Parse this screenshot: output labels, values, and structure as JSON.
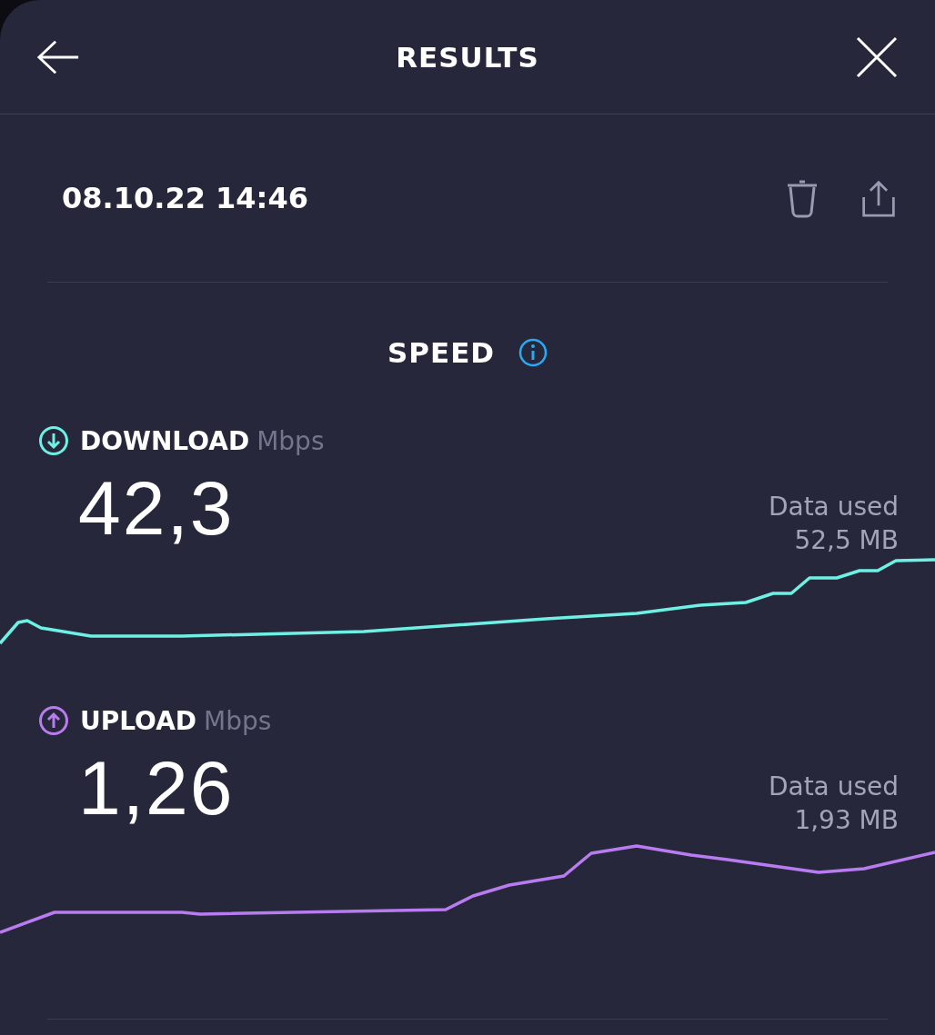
{
  "header": {
    "title": "RESULTS"
  },
  "result": {
    "datetime": "08.10.22 14:46"
  },
  "section": {
    "title": "SPEED"
  },
  "metrics": [
    {
      "label": "DOWNLOAD",
      "unit": "Mbps",
      "value": "42,3",
      "data_label": "Data used",
      "data_value": "52,5 MB",
      "kind": "down",
      "color": "#6ff0e4"
    },
    {
      "label": "UPLOAD",
      "unit": "Mbps",
      "value": "1,26",
      "data_label": "Data used",
      "data_value": "1,93 MB",
      "kind": "up",
      "color": "#b97cf0"
    }
  ]
}
